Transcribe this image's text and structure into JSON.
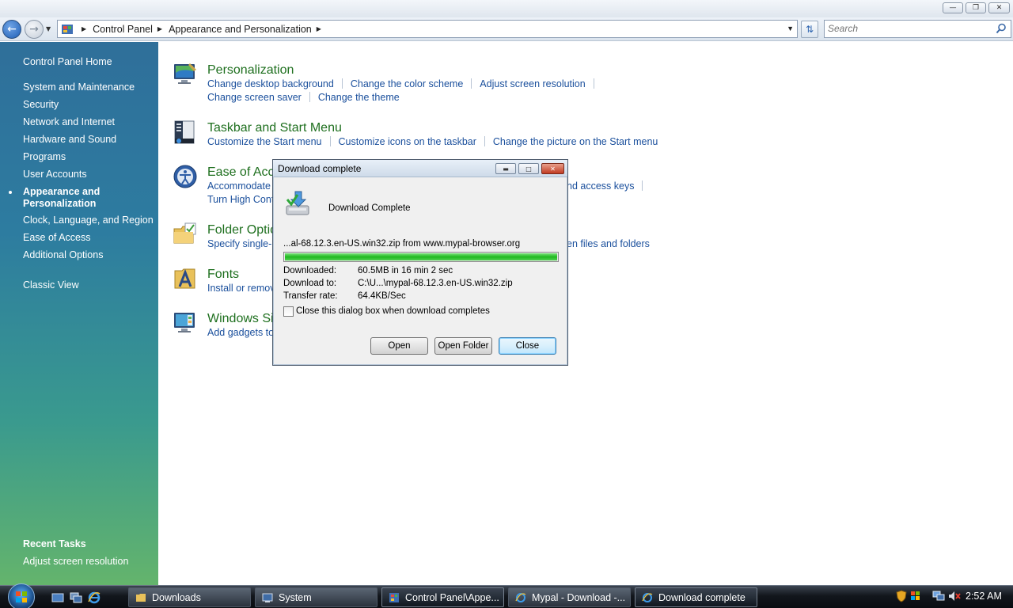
{
  "window": {
    "minimize_glyph": "—",
    "maximize_glyph": "❐",
    "close_glyph": "✕"
  },
  "address_bar": {
    "breadcrumbs": [
      "Control Panel",
      "Appearance and Personalization"
    ],
    "search_placeholder": "Search"
  },
  "left_pane": {
    "home": "Control Panel Home",
    "items": [
      "System and Maintenance",
      "Security",
      "Network and Internet",
      "Hardware and Sound",
      "Programs",
      "User Accounts",
      "Appearance and Personalization",
      "Clock, Language, and Region",
      "Ease of Access",
      "Additional Options"
    ],
    "current_item": "Appearance and Personalization",
    "classic_view": "Classic View",
    "recent_tasks_title": "Recent Tasks",
    "recent_tasks": [
      "Adjust screen resolution"
    ]
  },
  "categories": [
    {
      "icon": "personalization-icon",
      "title": "Personalization",
      "lines": [
        [
          "Change desktop background",
          "Change the color scheme",
          "Adjust screen resolution"
        ],
        [
          "Change screen saver",
          "Change the theme"
        ]
      ]
    },
    {
      "icon": "taskbar-icon",
      "title": "Taskbar and Start Menu",
      "lines": [
        [
          "Customize the Start menu",
          "Customize icons on the taskbar",
          "Change the picture on the Start menu"
        ]
      ]
    },
    {
      "icon": "ease-of-access-icon",
      "title": "Ease of Acce",
      "lines": [
        [
          "Accommodate"
        ],
        [
          "Turn High Cont"
        ]
      ],
      "right_fragment": "nd access keys"
    },
    {
      "icon": "folder-options-icon",
      "title": "Folder Optic",
      "lines": [
        [
          "Specify single-"
        ]
      ],
      "right_fragment": "en files and folders"
    },
    {
      "icon": "fonts-icon",
      "title": "Fonts",
      "lines": [
        [
          "Install or remov"
        ]
      ]
    },
    {
      "icon": "windows-sidebar-icon",
      "title": "Windows Si",
      "lines": [
        [
          "Add gadgets to"
        ]
      ]
    }
  ],
  "dialog": {
    "title": "Download complete",
    "heading": "Download Complete",
    "source": "...al-68.12.3.en-US.win32.zip from www.mypal-browser.org",
    "progress_fraction": 1.0,
    "downloaded_label": "Downloaded:",
    "downloaded_value": "60.5MB in 16 min 2 sec",
    "download_to_label": "Download to:",
    "download_to_value": "C:\\U...\\mypal-68.12.3.en-US.win32.zip",
    "transfer_rate_label": "Transfer rate:",
    "transfer_rate_value": "64.4KB/Sec",
    "checkbox_label": "Close this dialog box when download completes",
    "checkbox_checked": false,
    "buttons": {
      "open": "Open",
      "open_folder": "Open Folder",
      "close": "Close"
    }
  },
  "taskbar": {
    "tasks": [
      {
        "label": "Downloads",
        "icon": "folder-icon",
        "active": false
      },
      {
        "label": "System",
        "icon": "system-icon",
        "active": false
      },
      {
        "label": "Control Panel\\Appe...",
        "icon": "control-panel-icon",
        "active": true
      },
      {
        "label": "Mypal - Download -...",
        "icon": "browser-icon",
        "active": false
      },
      {
        "label": "Download complete",
        "icon": "browser-icon",
        "active": true
      }
    ],
    "clock": "2:52 AM"
  },
  "colors": {
    "link": "#1a4f9c",
    "category_title": "#1e6f1e",
    "progress": "#1fb81f"
  }
}
